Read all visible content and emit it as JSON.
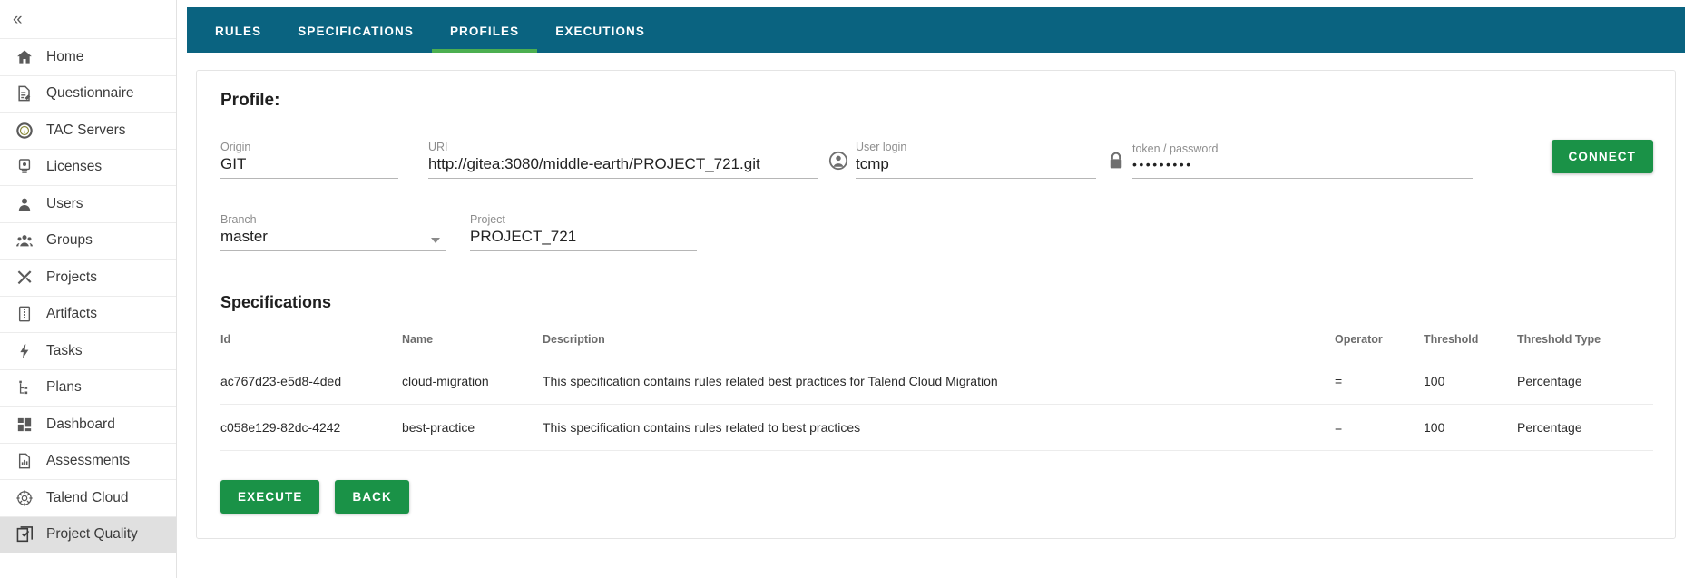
{
  "sidebar": {
    "collapse_icon": "«",
    "items": [
      {
        "label": "Home",
        "icon": "home-icon",
        "active": false
      },
      {
        "label": "Questionnaire",
        "icon": "questionnaire-icon",
        "active": false
      },
      {
        "label": "TAC Servers",
        "icon": "tac-servers-icon",
        "active": false
      },
      {
        "label": "Licenses",
        "icon": "license-badge-icon",
        "active": false
      },
      {
        "label": "Users",
        "icon": "user-icon",
        "active": false
      },
      {
        "label": "Groups",
        "icon": "groups-icon",
        "active": false
      },
      {
        "label": "Projects",
        "icon": "tools-icon",
        "active": false
      },
      {
        "label": "Artifacts",
        "icon": "artifact-icon",
        "active": false
      },
      {
        "label": "Tasks",
        "icon": "lightning-icon",
        "active": false
      },
      {
        "label": "Plans",
        "icon": "plans-tree-icon",
        "active": false
      },
      {
        "label": "Dashboard",
        "icon": "dashboard-grid-icon",
        "active": false
      },
      {
        "label": "Assessments",
        "icon": "assessments-chart-icon",
        "active": false
      },
      {
        "label": "Talend Cloud",
        "icon": "talend-cloud-icon",
        "active": false
      },
      {
        "label": "Project Quality",
        "icon": "project-quality-icon",
        "active": true
      }
    ]
  },
  "tabs": [
    {
      "label": "RULES",
      "active": false
    },
    {
      "label": "SPECIFICATIONS",
      "active": false
    },
    {
      "label": "PROFILES",
      "active": true
    },
    {
      "label": "EXECUTIONS",
      "active": false
    }
  ],
  "profile": {
    "title": "Profile:",
    "fields": {
      "origin": {
        "label": "Origin",
        "value": "GIT"
      },
      "uri": {
        "label": "URI",
        "value": "http://gitea:3080/middle-earth/PROJECT_721.git"
      },
      "user_login": {
        "label": "User login",
        "value": "tcmp",
        "icon": "person-icon"
      },
      "token": {
        "label": "token / password",
        "value": "•••••••••",
        "icon": "lock-icon"
      },
      "branch": {
        "label": "Branch",
        "value": "master",
        "icon": "chevron-down-icon"
      },
      "project": {
        "label": "Project",
        "value": "PROJECT_721"
      }
    },
    "connect_label": "CONNECT"
  },
  "specifications": {
    "title": "Specifications",
    "columns": [
      "Id",
      "Name",
      "Description",
      "Operator",
      "Threshold",
      "Threshold Type"
    ],
    "rows": [
      {
        "id": "ac767d23-e5d8-4ded",
        "name": "cloud-migration",
        "description": "This specification contains rules related best practices for Talend Cloud Migration",
        "operator": "=",
        "threshold": "100",
        "threshold_type": "Percentage"
      },
      {
        "id": "c058e129-82dc-4242",
        "name": "best-practice",
        "description": "This specification contains rules related to best practices",
        "operator": "=",
        "threshold": "100",
        "threshold_type": "Percentage"
      }
    ]
  },
  "actions": {
    "execute_label": "EXECUTE",
    "back_label": "BACK"
  },
  "colors": {
    "tabbar_teal": "#0a6380",
    "active_tab_underline": "#4caf50",
    "button_green": "#1a9247",
    "sidebar_active_bg": "#e0e0e0"
  }
}
